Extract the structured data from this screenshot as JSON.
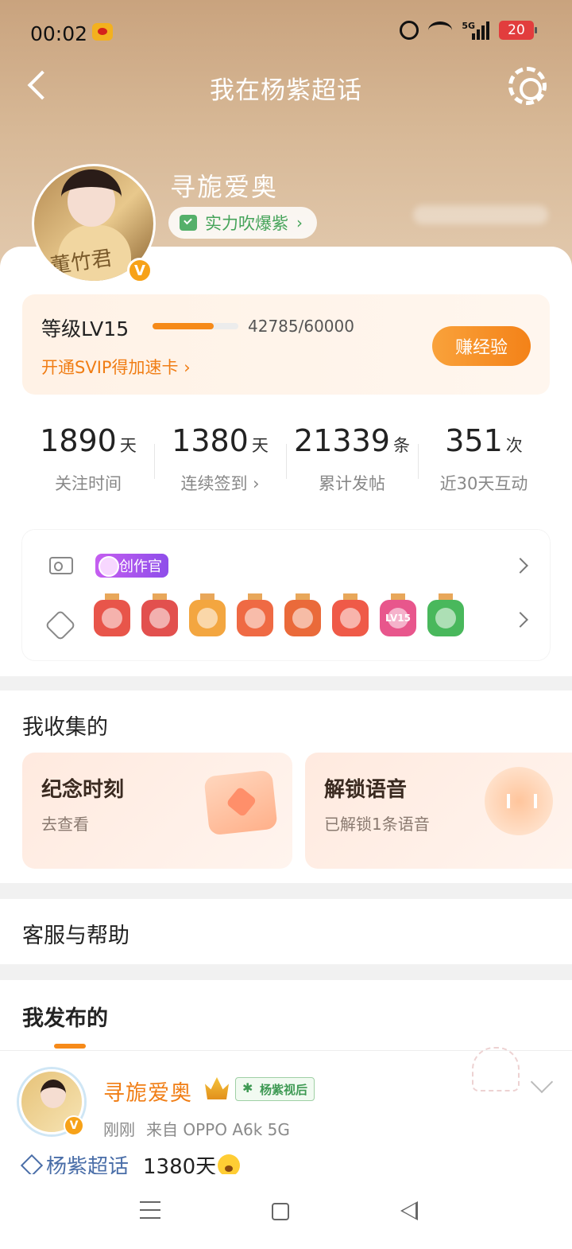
{
  "status_bar": {
    "time": "00:02",
    "network_label": "5G",
    "battery_level": "20"
  },
  "nav": {
    "title": "我在杨紫超话"
  },
  "profile": {
    "username": "寻旎爱奥",
    "title_chip": "实力吹爆紫",
    "avatar_caption": "董竹君",
    "verified_mark": "V"
  },
  "level": {
    "label": "等级LV15",
    "exp_text": "42785/60000",
    "progress": 0.713,
    "svip_link": "开通SVIP得加速卡",
    "earn_button": "赚经验"
  },
  "stats": [
    {
      "value": "1890",
      "unit": "天",
      "label": "关注时间"
    },
    {
      "value": "1380",
      "unit": "天",
      "label": "连续签到"
    },
    {
      "value": "21339",
      "unit": "条",
      "label": "累计发帖"
    },
    {
      "value": "351",
      "unit": "次",
      "label": "近30天互动"
    }
  ],
  "badges": {
    "creator_tag": "创作官",
    "medal_colors": [
      "#e8554a",
      "#e2504e",
      "#f3a640",
      "#ef6a44",
      "#ea6a3a",
      "#ef5a48",
      "#e8568c",
      "#49b85c"
    ],
    "lv_medal_text": "LV15"
  },
  "collections": {
    "title": "我收集的",
    "cards": [
      {
        "title": "纪念时刻",
        "subtitle": "去查看"
      },
      {
        "title": "解锁语音",
        "subtitle": "已解锁1条语音"
      }
    ]
  },
  "help": {
    "label": "客服与帮助"
  },
  "posts": {
    "tab_label": "我发布的",
    "item": {
      "author": "寻旎爱奥",
      "fan_tag": "杨紫视后",
      "time": "刚刚",
      "source": "来自 OPPO A6k 5G",
      "topic": "杨紫超话",
      "text": "1380天"
    }
  },
  "colors": {
    "accent": "#f68a19",
    "header_top": "#c9a37e",
    "fan_tag_green": "#3f9a54",
    "topic_blue": "#4a6ea8"
  }
}
